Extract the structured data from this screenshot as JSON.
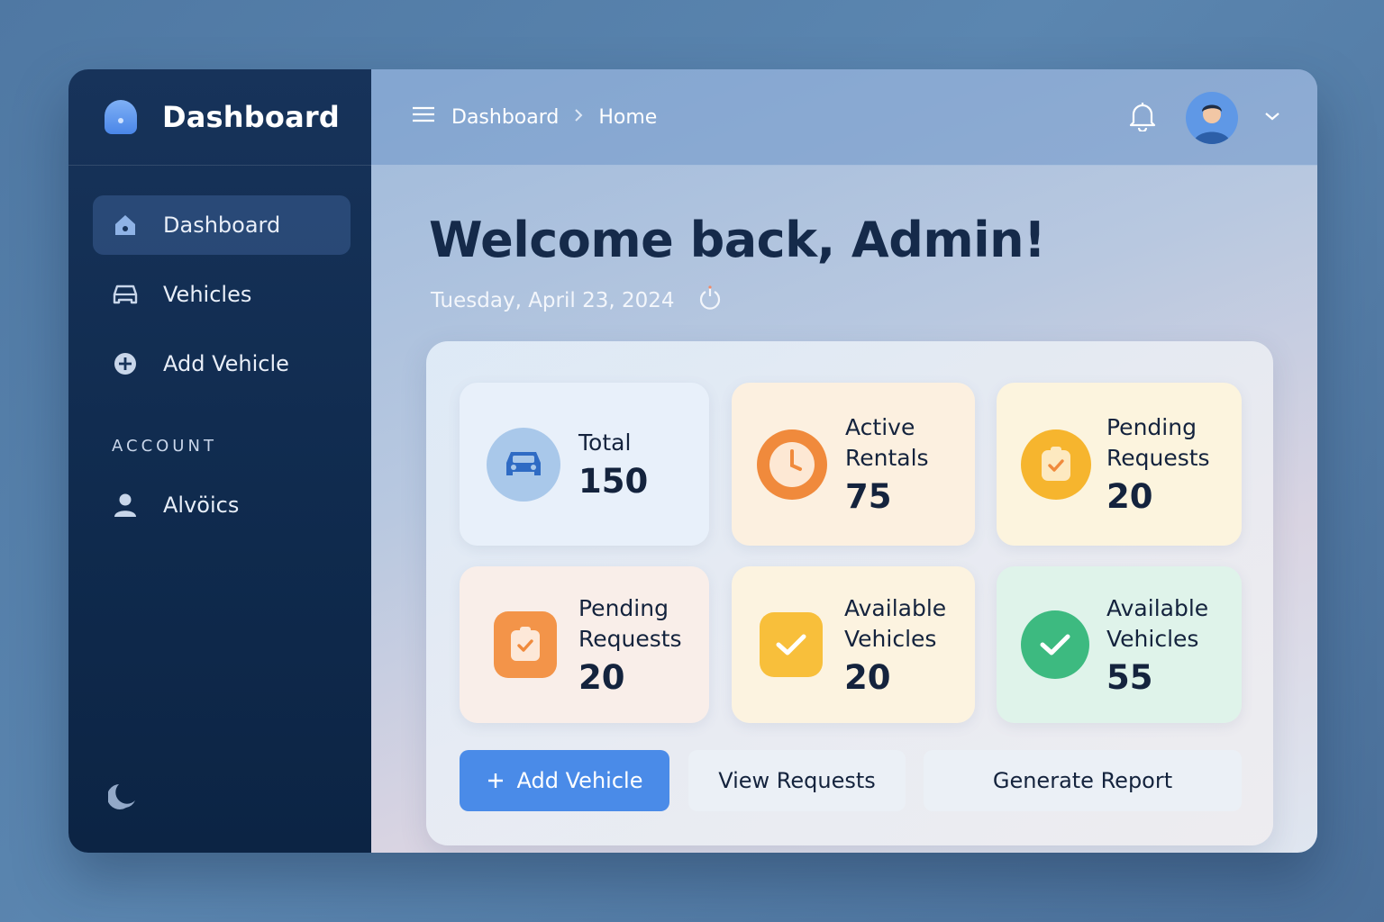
{
  "brand": {
    "title": "Dashboard",
    "logo_icon": "dome-logo-icon"
  },
  "sidebar": {
    "items": [
      {
        "label": "Dashboard",
        "icon": "home-icon",
        "active": true
      },
      {
        "label": "Vehicles",
        "icon": "car-icon",
        "active": false
      },
      {
        "label": "Add Vehicle",
        "icon": "plus-circle-icon",
        "active": false
      }
    ],
    "section_label": "ACCOUNT",
    "account_items": [
      {
        "label": "Alvöics",
        "icon": "user-icon"
      }
    ],
    "theme_icon": "moon-icon"
  },
  "header": {
    "breadcrumb": [
      "Dashboard",
      "Home"
    ],
    "icons": [
      "menu-icon",
      "chevron-right-icon",
      "bell-icon",
      "avatar",
      "chevron-down-icon"
    ]
  },
  "main": {
    "welcome": "Welcome back, Admin!",
    "date": "Tuesday, April 23, 2024"
  },
  "stats": [
    {
      "label": "Total",
      "value": "150",
      "icon": "car-icon"
    },
    {
      "label": "Active Rentals",
      "value": "75",
      "icon": "clock-icon"
    },
    {
      "label": "Pending Requests",
      "value": "20",
      "icon": "clipboard-check-icon"
    },
    {
      "label": "Pending Requests",
      "value": "20",
      "icon": "clipboard-check-icon"
    },
    {
      "label": "Available Vehicles",
      "value": "20",
      "icon": "check-icon"
    },
    {
      "label": "Available Vehicles",
      "value": "55",
      "icon": "check-icon"
    }
  ],
  "actions": {
    "add_vehicle": "Add Vehicle",
    "view_requests": "View Requests",
    "generate_report": "Generate Report"
  },
  "colors": {
    "sidebar_bg": "#0f2a4d",
    "accent": "#4a8be8",
    "orange": "#f08a3c",
    "amber": "#f6b52e",
    "green": "#3dba80"
  }
}
